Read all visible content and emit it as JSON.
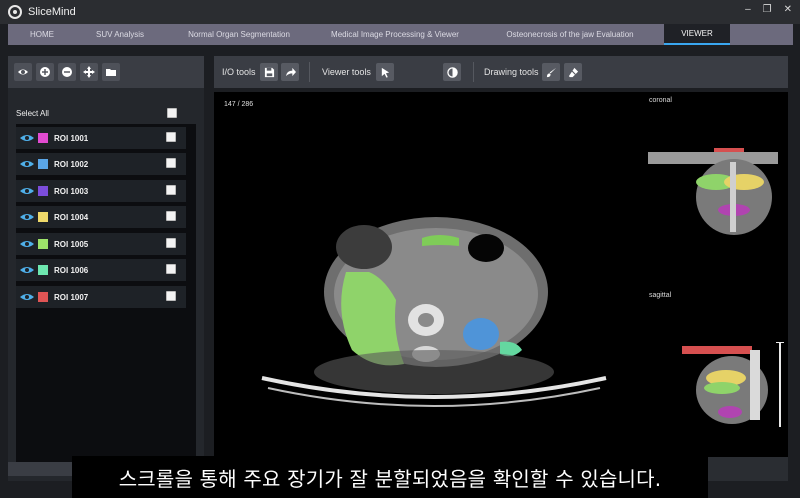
{
  "app": {
    "title": "SliceMind",
    "window_controls": [
      "–",
      "❐",
      "✕"
    ]
  },
  "tabs": [
    {
      "label": "HOME",
      "active": false
    },
    {
      "label": "SUV Analysis",
      "active": false
    },
    {
      "label": "Normal Organ Segmentation",
      "active": false
    },
    {
      "label": "Medical Image Processing & Viewer",
      "active": false
    },
    {
      "label": "Osteonecrosis of the jaw Evaluation",
      "active": false
    },
    {
      "label": "VIEWER",
      "active": true
    }
  ],
  "left_toolbar": {
    "icons": [
      "eye-icon",
      "zoom-in-icon",
      "zoom-out-icon",
      "move-icon",
      "folder-icon"
    ]
  },
  "roi_panel": {
    "select_all_label": "Select All",
    "items": [
      {
        "label": "ROI 1001",
        "color": "#e24bd1"
      },
      {
        "label": "ROI 1002",
        "color": "#5aa6e8"
      },
      {
        "label": "ROI 1003",
        "color": "#7c4ddb"
      },
      {
        "label": "ROI 1004",
        "color": "#efd96a"
      },
      {
        "label": "ROI 1005",
        "color": "#9ee36a"
      },
      {
        "label": "ROI 1006",
        "color": "#6ee8b0"
      },
      {
        "label": "ROI 1007",
        "color": "#e05555"
      }
    ]
  },
  "main_toolbar": {
    "io_label": "I/O tools",
    "viewer_label": "Viewer tools",
    "drawing_label": "Drawing tools"
  },
  "viewer": {
    "slice_counter": "147 / 286",
    "coronal_label": "coronal",
    "sagittal_label": "sagittal"
  },
  "subtitle": "스크롤을 통해 주요 장기가 잘 분할되었음을 확인할 수 있습니다."
}
